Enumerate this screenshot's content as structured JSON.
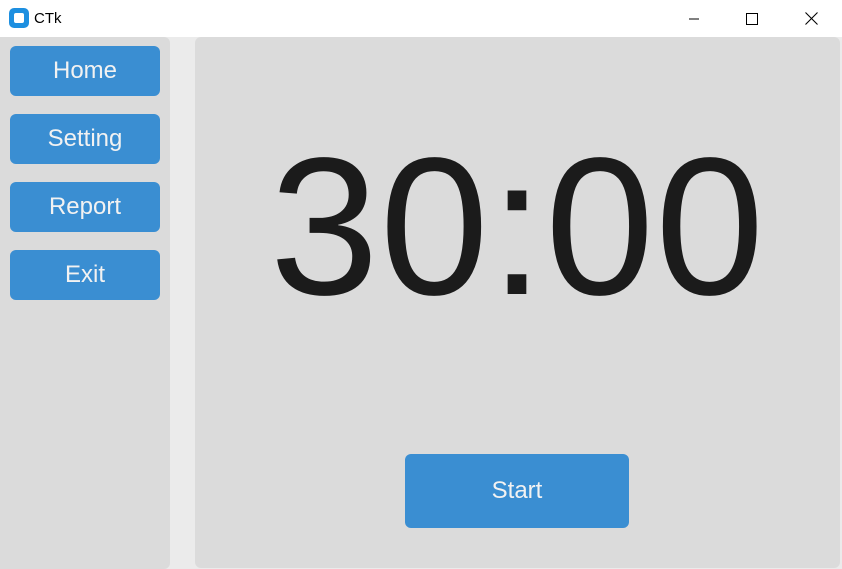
{
  "window": {
    "title": "CTk"
  },
  "sidebar": {
    "items": [
      {
        "label": "Home"
      },
      {
        "label": "Setting"
      },
      {
        "label": "Report"
      },
      {
        "label": "Exit"
      }
    ]
  },
  "main": {
    "timer_display": "30:00",
    "start_label": "Start"
  },
  "colors": {
    "accent": "#3a8ed2",
    "panel": "#dbdbdb",
    "background": "#ebebeb",
    "button_text": "#f2f2f2",
    "timer_text": "#1b1b1b"
  },
  "icons": {
    "app": "ctk-app-icon",
    "minimize": "minimize-icon",
    "maximize": "maximize-icon",
    "close": "close-icon"
  }
}
